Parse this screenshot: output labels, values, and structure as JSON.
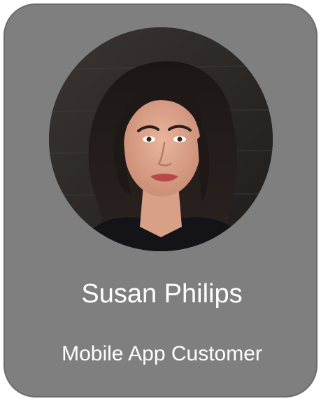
{
  "profile": {
    "name": "Susan Philips",
    "role": "Mobile App Customer"
  },
  "colors": {
    "card_background": "#7f7f7f",
    "text": "#ffffff"
  },
  "icons": {
    "photo": "woman-portrait-photo"
  }
}
